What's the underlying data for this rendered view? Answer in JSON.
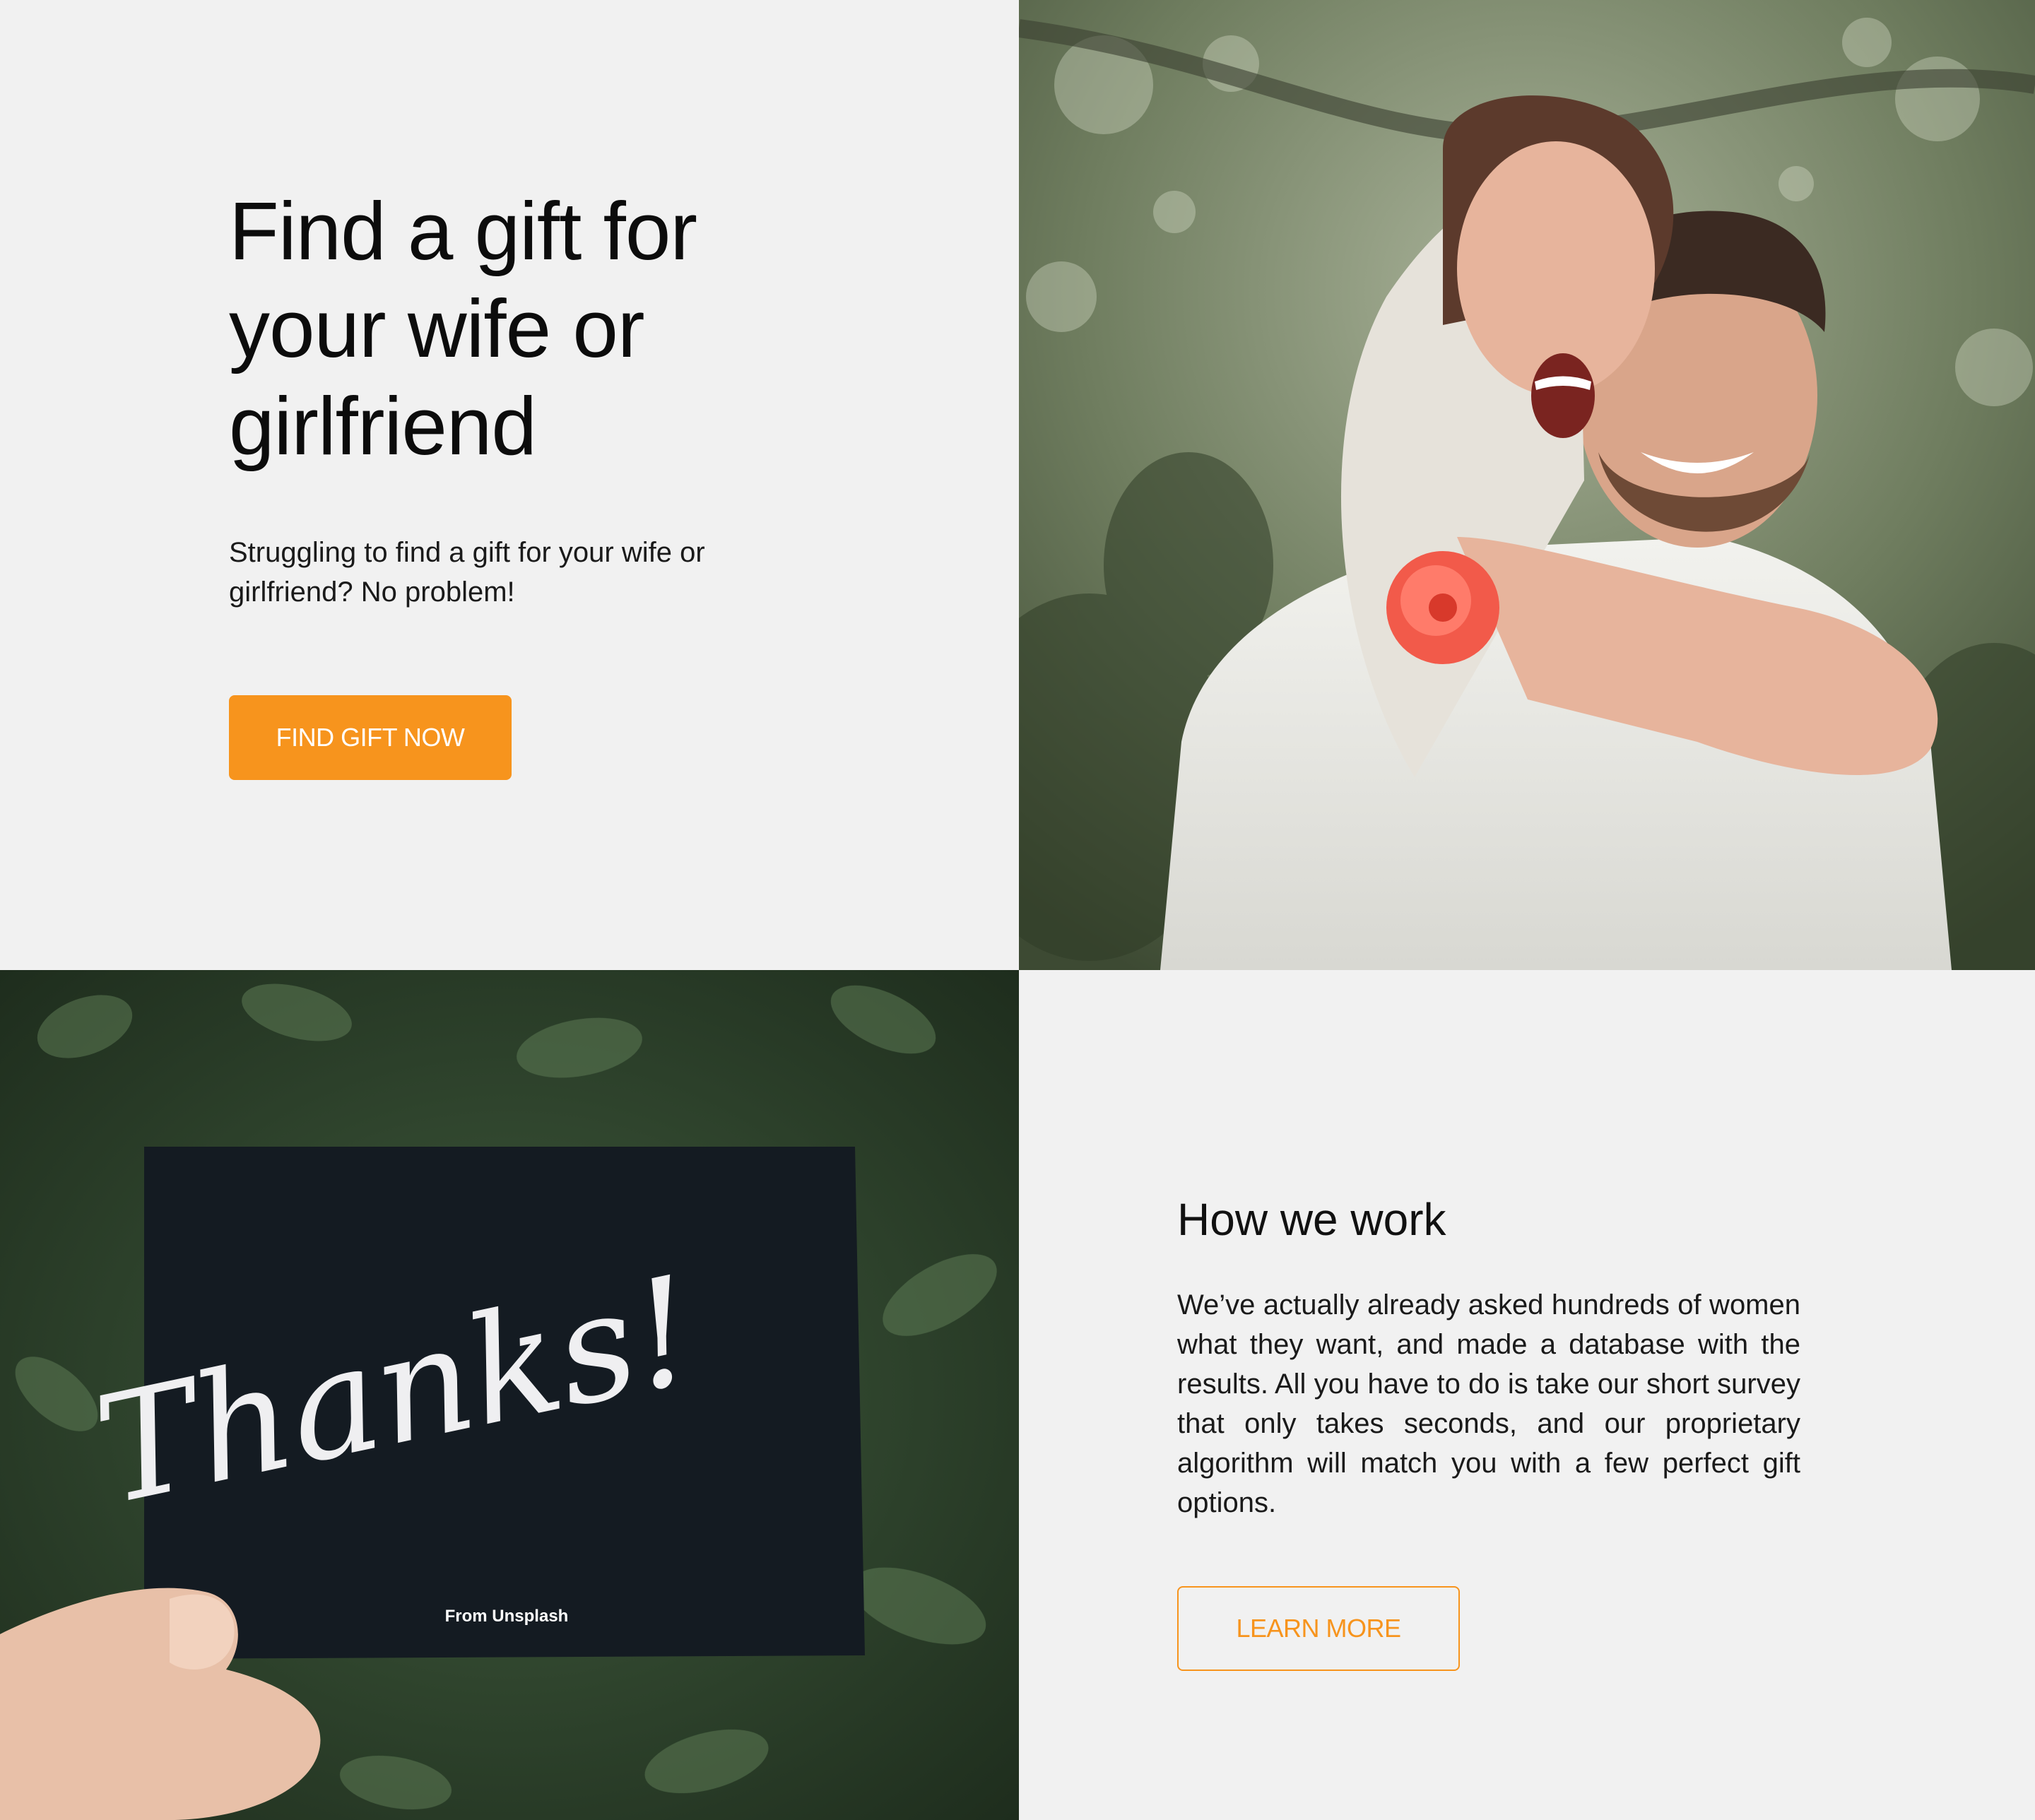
{
  "hero": {
    "title": "Find a gift for your wife or girlfriend",
    "subtitle": "Struggling to find a gift for your wife or girlfriend?  No problem!",
    "cta_label": "FIND GIFT NOW"
  },
  "photos": {
    "card_script": "Thanks!",
    "card_footer": "From Unsplash"
  },
  "how": {
    "title": "How we work",
    "body": "We’ve actually already asked hundreds of women what they want, and made a database with the results. All you have to do is take our short survey that only takes seconds, and our proprietary algorithm will match you with a few perfect gift options.",
    "cta_label": "LEARN MORE"
  },
  "colors": {
    "accent": "#f7941d",
    "background": "#f1f1f1",
    "text": "#111111"
  }
}
